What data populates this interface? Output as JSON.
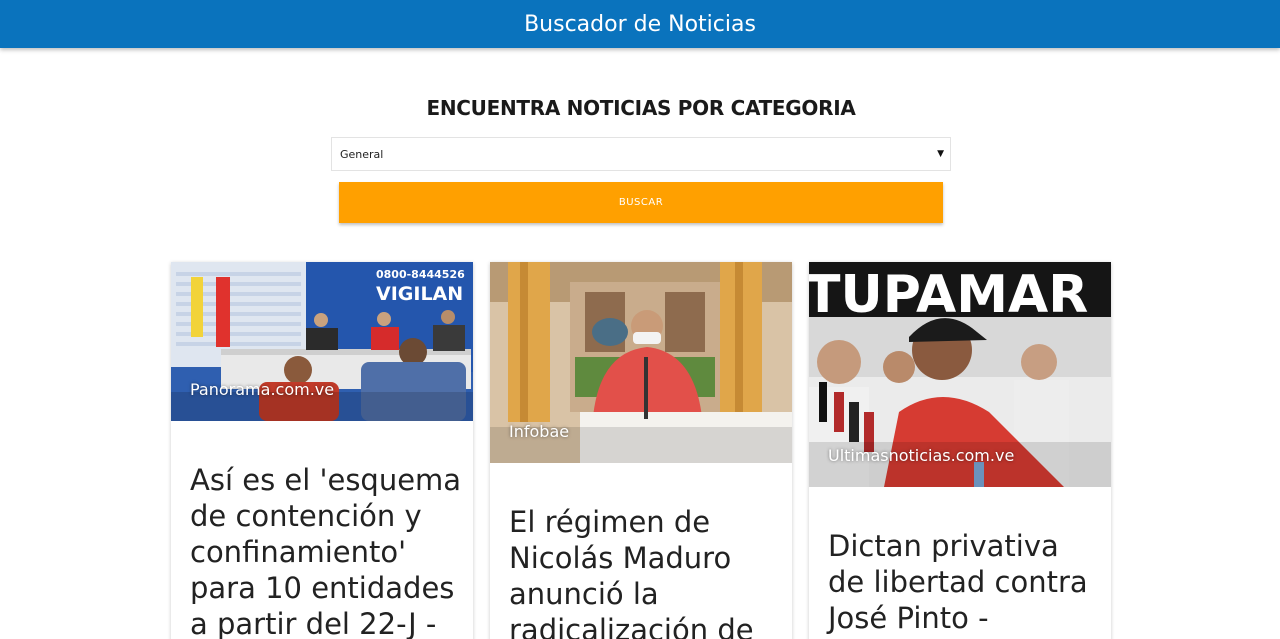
{
  "header": {
    "title": "Buscador de Noticias"
  },
  "main": {
    "heading": "ENCUENTRA NOTICIAS POR CATEGORIA",
    "category_select": {
      "selected": "General"
    },
    "search_button": "BUSCAR"
  },
  "cards": [
    {
      "source": "Panorama.com.ve",
      "title": "Así es el 'esquema de contención y confinamiento' para 10 entidades a partir del 22-J -",
      "image_sign_top": "0800-8444526",
      "image_sign_main": "VIGILAN"
    },
    {
      "source": "Infobae",
      "title": "El régimen de Nicolás Maduro anunció la radicalización de"
    },
    {
      "source": "Ultimasnoticias.com.ve",
      "title": "Dictan privativa de libertad contra José Pinto -",
      "image_banner": "TUPAMAR"
    }
  ],
  "colors": {
    "header": "#0a73bd",
    "button": "#ffa000"
  }
}
